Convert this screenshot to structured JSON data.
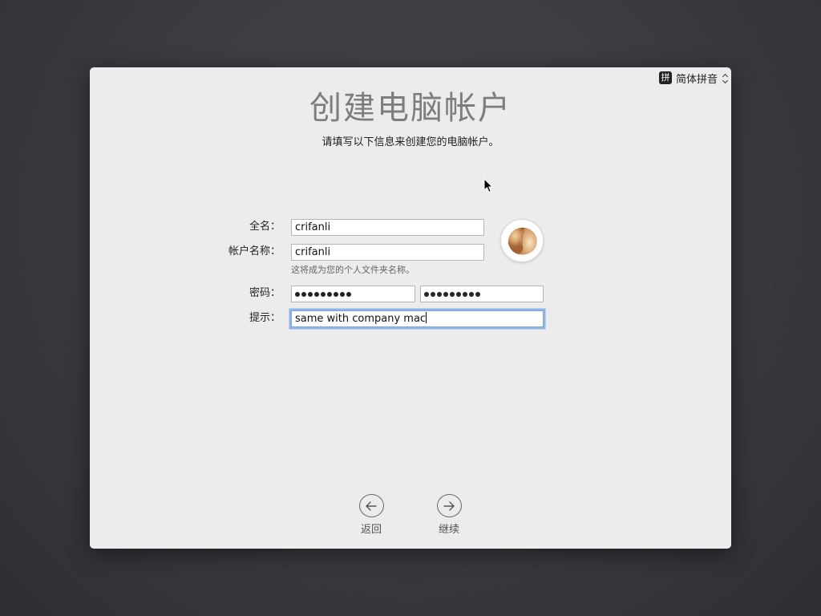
{
  "input_menu": {
    "badge": "拼",
    "label": "简体拼音"
  },
  "header": {
    "title": "创建电脑帐户",
    "subtitle": "请填写以下信息来创建您的电脑帐户。"
  },
  "form": {
    "full_name": {
      "label": "全名：",
      "value": "crifanli"
    },
    "account_name": {
      "label": "帐户名称：",
      "value": "crifanli",
      "note": "这将成为您的个人文件夹名称。"
    },
    "password": {
      "label": "密码：",
      "dot_count": 9,
      "verify_dot_count": 9
    },
    "hint": {
      "label": "提示：",
      "value": "same with company mac"
    }
  },
  "nav": {
    "back_label": "返回",
    "continue_label": "继续"
  },
  "colors": {
    "background": "#3a3a3f",
    "window": "#ececec",
    "focus_ring": "#8fb4ea",
    "title": "#7d7d7d"
  },
  "icons": {
    "avatar": "fortune-cookie-icon",
    "back": "arrow-left-circle-icon",
    "continue": "arrow-right-circle-icon",
    "input_menu": "updown-chevron-icon"
  }
}
